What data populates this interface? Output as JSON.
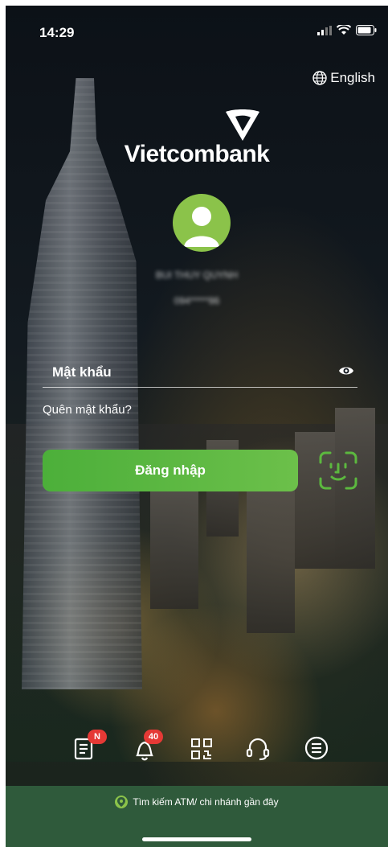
{
  "status_bar": {
    "time": "14:29"
  },
  "language": {
    "label": "English"
  },
  "brand": {
    "name": "Vietcombank"
  },
  "user": {
    "name": "BUI THUY QUYNH",
    "phone": "094*****86"
  },
  "password": {
    "label": "Mật khẩu"
  },
  "forgot_password": {
    "label": "Quên mật khẩu?"
  },
  "login": {
    "label": "Đăng nhập"
  },
  "bottom_bar": {
    "news_badge": "N",
    "notifications_badge": "40"
  },
  "footer": {
    "atm_search_label": "Tìm kiếm ATM/ chi nhánh gần đây"
  },
  "colors": {
    "accent_green": "#5cb83f",
    "footer_green": "#2f5a3b",
    "badge_red": "#e53935"
  }
}
